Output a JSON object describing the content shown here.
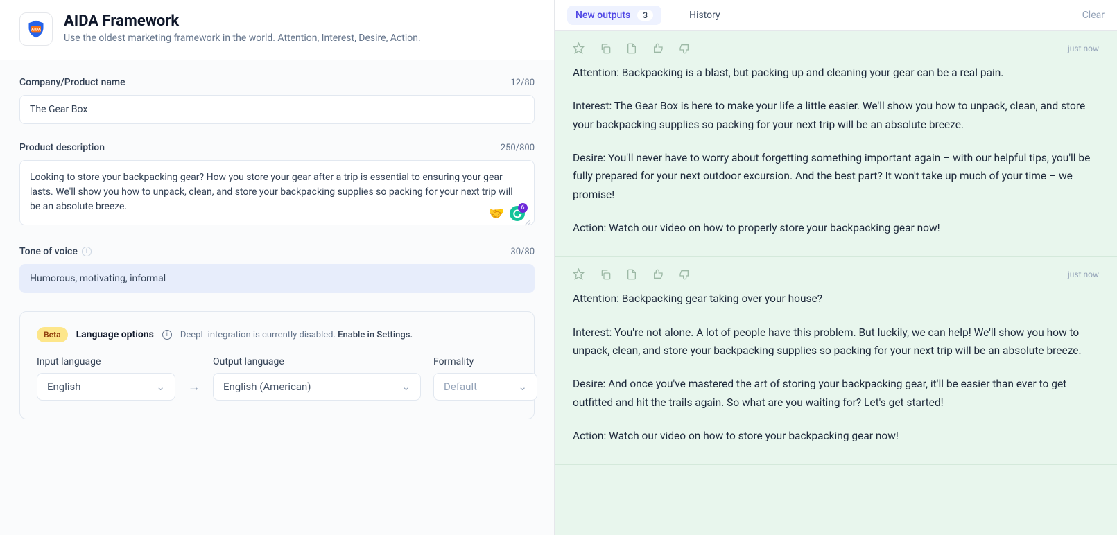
{
  "header": {
    "title": "AIDA Framework",
    "subtitle": "Use the oldest marketing framework in the world. Attention, Interest, Desire, Action.",
    "icon_label": "AIDA"
  },
  "fields": {
    "company": {
      "label": "Company/Product name",
      "value": "The Gear Box",
      "counter": "12/80"
    },
    "description": {
      "label": "Product description",
      "value": "Looking to store your backpacking gear? How you store your gear after a trip is essential to ensuring your gear lasts. We'll show you how to unpack, clean, and store your backpacking supplies so packing for your next trip will be an absolute breeze.",
      "counter": "250/800"
    },
    "tone": {
      "label": "Tone of voice",
      "value": "Humorous, motivating, informal",
      "counter": "30/80"
    }
  },
  "language": {
    "badge": "Beta",
    "title": "Language options",
    "note_prefix": "DeepL integration is currently disabled. ",
    "note_link": "Enable in Settings.",
    "input_label": "Input language",
    "input_value": "English",
    "output_label": "Output language",
    "output_value": "English (American)",
    "formality_label": "Formality",
    "formality_value": "Default"
  },
  "tabs": {
    "new_outputs": "New outputs",
    "count": "3",
    "history": "History",
    "clear": "Clear"
  },
  "outputs": [
    {
      "timestamp": "just now",
      "paragraphs": [
        "Attention: Backpacking is a blast, but packing up and cleaning your gear can be a real pain.",
        "Interest: The Gear Box is here to make your life a little easier. We'll show you how to unpack, clean, and store your backpacking supplies so packing for your next trip will be an absolute breeze.",
        "Desire: You'll never have to worry about forgetting something important again – with our helpful tips, you'll be fully prepared for your next outdoor excursion. And the best part? It won't take up much of your time – we promise!",
        "Action: Watch our video on how to properly store your backpacking gear now!"
      ]
    },
    {
      "timestamp": "just now",
      "paragraphs": [
        "Attention: Backpacking gear taking over your house?",
        "Interest: You're not alone. A lot of people have this problem. But luckily, we can help! We'll show you how to unpack, clean, and store your backpacking supplies so packing for your next trip will be an absolute breeze.",
        "Desire: And once you've mastered the art of storing your backpacking gear, it'll be easier than ever to get outfitted and hit the trails again. So what are you waiting for? Let's get started!",
        "Action: Watch our video on how to store your backpacking gear now!"
      ]
    }
  ]
}
